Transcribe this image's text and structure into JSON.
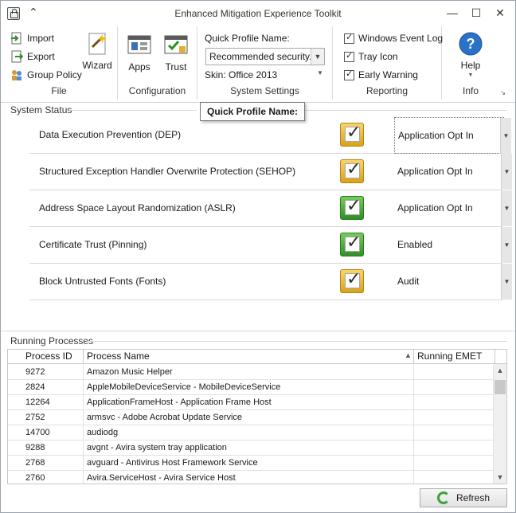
{
  "window": {
    "title": "Enhanced Mitigation Experience Toolkit",
    "controls": [
      "—",
      "☐",
      "✕"
    ]
  },
  "ribbon": {
    "file": {
      "label": "File",
      "import_label": "Import",
      "export_label": "Export",
      "group_policy_label": "Group Policy",
      "wizard_label": "Wizard"
    },
    "configuration": {
      "label": "Configuration",
      "apps_label": "Apps",
      "trust_label": "Trust"
    },
    "system_settings": {
      "label": "System Settings",
      "quick_profile_label": "Quick Profile Name:",
      "quick_profile_value": "Recommended security...",
      "skin_label": "Skin: Office 2013"
    },
    "reporting": {
      "label": "Reporting",
      "windows_event_log": "Windows Event Log",
      "tray_icon": "Tray Icon",
      "early_warning": "Early Warning"
    },
    "info": {
      "label": "Info",
      "help_label": "Help"
    }
  },
  "tooltip": "Quick Profile Name:",
  "system_status": {
    "title": "System Status",
    "rows": [
      {
        "name": "Data Execution Prevention (DEP)",
        "value": "Application Opt In",
        "color": "yellow"
      },
      {
        "name": "Structured Exception Handler Overwrite Protection (SEHOP)",
        "value": "Application Opt In",
        "color": "yellow"
      },
      {
        "name": "Address Space Layout Randomization (ASLR)",
        "value": "Application Opt In",
        "color": "green"
      },
      {
        "name": "Certificate Trust (Pinning)",
        "value": "Enabled",
        "color": "green"
      },
      {
        "name": "Block Untrusted Fonts (Fonts)",
        "value": "Audit",
        "color": "yellow"
      }
    ]
  },
  "running_processes": {
    "title": "Running Processes",
    "columns": [
      "Process ID",
      "Process Name",
      "Running EMET"
    ],
    "rows": [
      {
        "id": "9272",
        "name": "Amazon Music Helper"
      },
      {
        "id": "2824",
        "name": "AppleMobileDeviceService - MobileDeviceService"
      },
      {
        "id": "12264",
        "name": "ApplicationFrameHost - Application Frame Host"
      },
      {
        "id": "2752",
        "name": "armsvc - Adobe Acrobat Update Service"
      },
      {
        "id": "14700",
        "name": "audiodg"
      },
      {
        "id": "9288",
        "name": "avgnt - Avira system tray application"
      },
      {
        "id": "2768",
        "name": "avguard - Antivirus Host Framework Service"
      },
      {
        "id": "2760",
        "name": "Avira.ServiceHost - Avira Service Host"
      }
    ]
  },
  "refresh_label": "Refresh",
  "colors": {
    "yellow_check": "#e0b030",
    "green_check": "#3fa32e",
    "accent": "#1e6fc8"
  }
}
